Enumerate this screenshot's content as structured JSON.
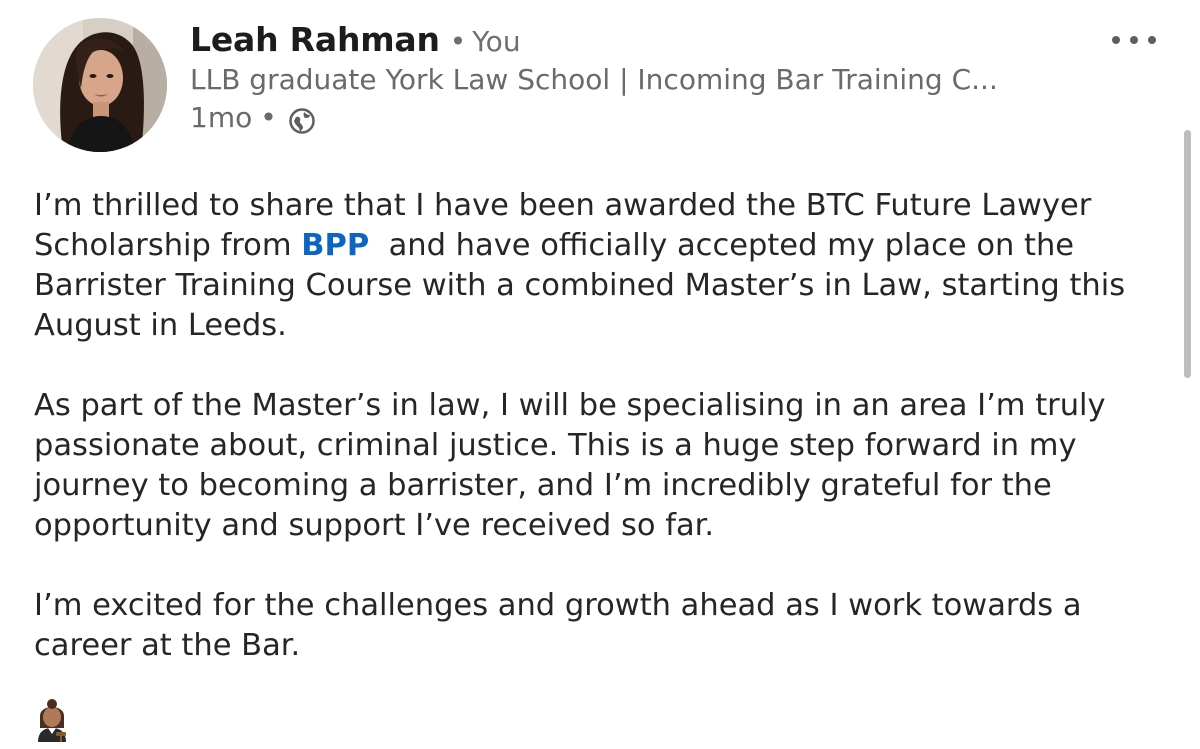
{
  "post": {
    "author": {
      "name": "Leah Rahman",
      "separator": "•",
      "relationship": "You",
      "headline": "LLB graduate York Law School | Incoming Bar Training C...",
      "timestamp": "1mo",
      "meta_separator": "•",
      "visibility_icon": "globe-icon"
    },
    "more_icon": "more-horizontal-icon",
    "body": {
      "p1_before": "I’m thrilled to share that I have been awarded the BTC Future Lawyer Scholarship from ",
      "p1_mention": "BPP",
      "p1_after": "  and have officially accepted my place on the Barrister Training Course with a combined Master’s in Law, starting this August in Leeds.",
      "p2": "As part of the Master’s in law, I will be specialising in an area I’m truly passionate about, criminal justice. This is a huge step forward in my journey to becoming a barrister, and I’m incredibly grateful for the opportunity and support I’ve received so far.",
      "p3": "I’m excited for the challenges and growth ahead as I work towards a career at the Bar.",
      "emoji_icon": "woman-judge-emoji-icon"
    },
    "colors": {
      "mention": "#0a66c2",
      "text": "#262626",
      "secondary_text": "#6a6a6a"
    }
  }
}
